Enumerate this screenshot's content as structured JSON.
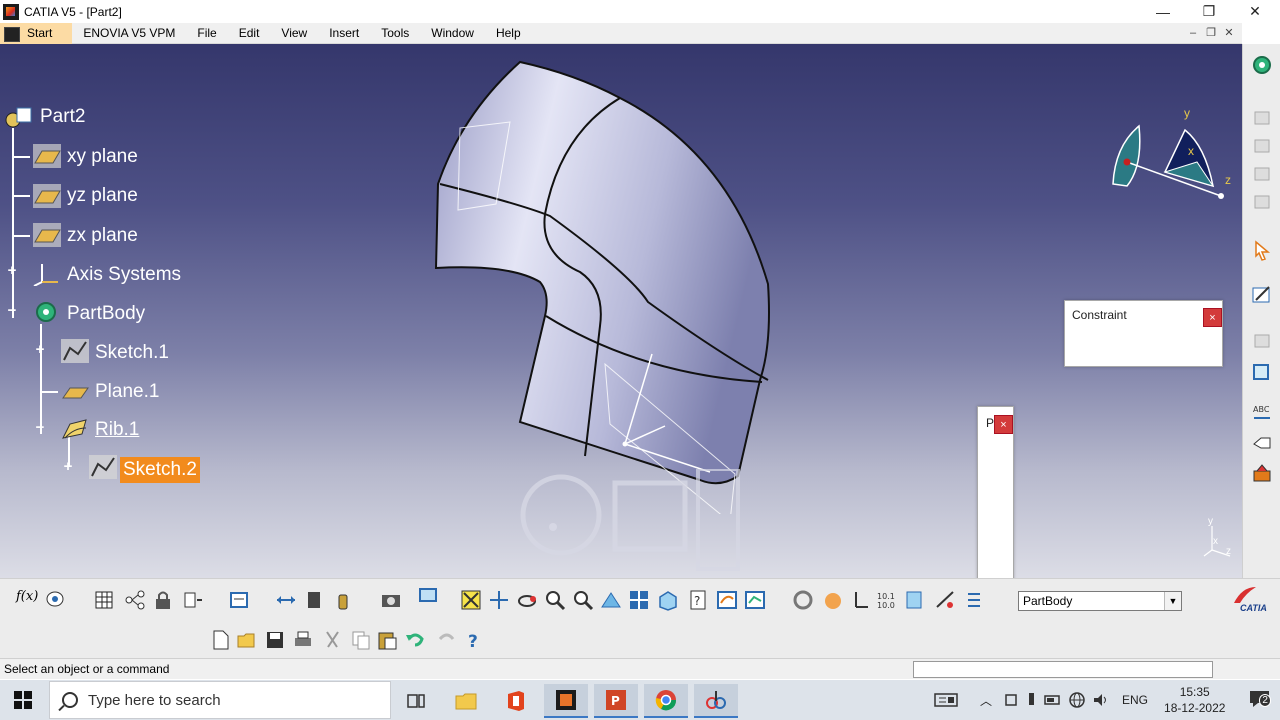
{
  "window": {
    "title": "CATIA V5 - [Part2]",
    "minimize": "—",
    "maximize": "❐",
    "close": "✕"
  },
  "menu": {
    "items": [
      "Start",
      "ENOVIA V5 VPM",
      "File",
      "Edit",
      "View",
      "Insert",
      "Tools",
      "Window",
      "Help"
    ],
    "mdi_min": "–",
    "mdi_restore": "❐",
    "mdi_close": "✕"
  },
  "tree": {
    "root": "Part2",
    "nodes": {
      "xy": "xy plane",
      "yz": "yz plane",
      "zx": "zx plane",
      "axis": "Axis Systems",
      "body": "PartBody",
      "sketch1": "Sketch.1",
      "plane1": "Plane.1",
      "rib": "Rib.1",
      "sketch2": "Sketch.2"
    }
  },
  "compass": {
    "x": "x",
    "y": "y",
    "z": "z"
  },
  "axis_small": {
    "x": "x",
    "y": "y",
    "z": "z"
  },
  "dialogs": {
    "constraint": {
      "title": "Constraint",
      "close": "×"
    },
    "small": {
      "title": "P",
      "close": "×"
    }
  },
  "toolbar": {
    "current_body": "PartBody",
    "combo_arrow": "▼",
    "brand": "CATIA",
    "formula_label": "f(x)",
    "undo_icon": "undo-icon"
  },
  "status": {
    "prompt": "Select an object or a command"
  },
  "taskbar": {
    "search_placeholder": "Type here to search",
    "language": "ENG",
    "time": "15:35",
    "date": "18-12-2022",
    "notification_count": "2"
  },
  "colors": {
    "accent_selected": "#f28b1d",
    "viewport_top": "#35376c",
    "viewport_bottom": "#dcdde6",
    "part_surface": "#b4b6d8"
  }
}
